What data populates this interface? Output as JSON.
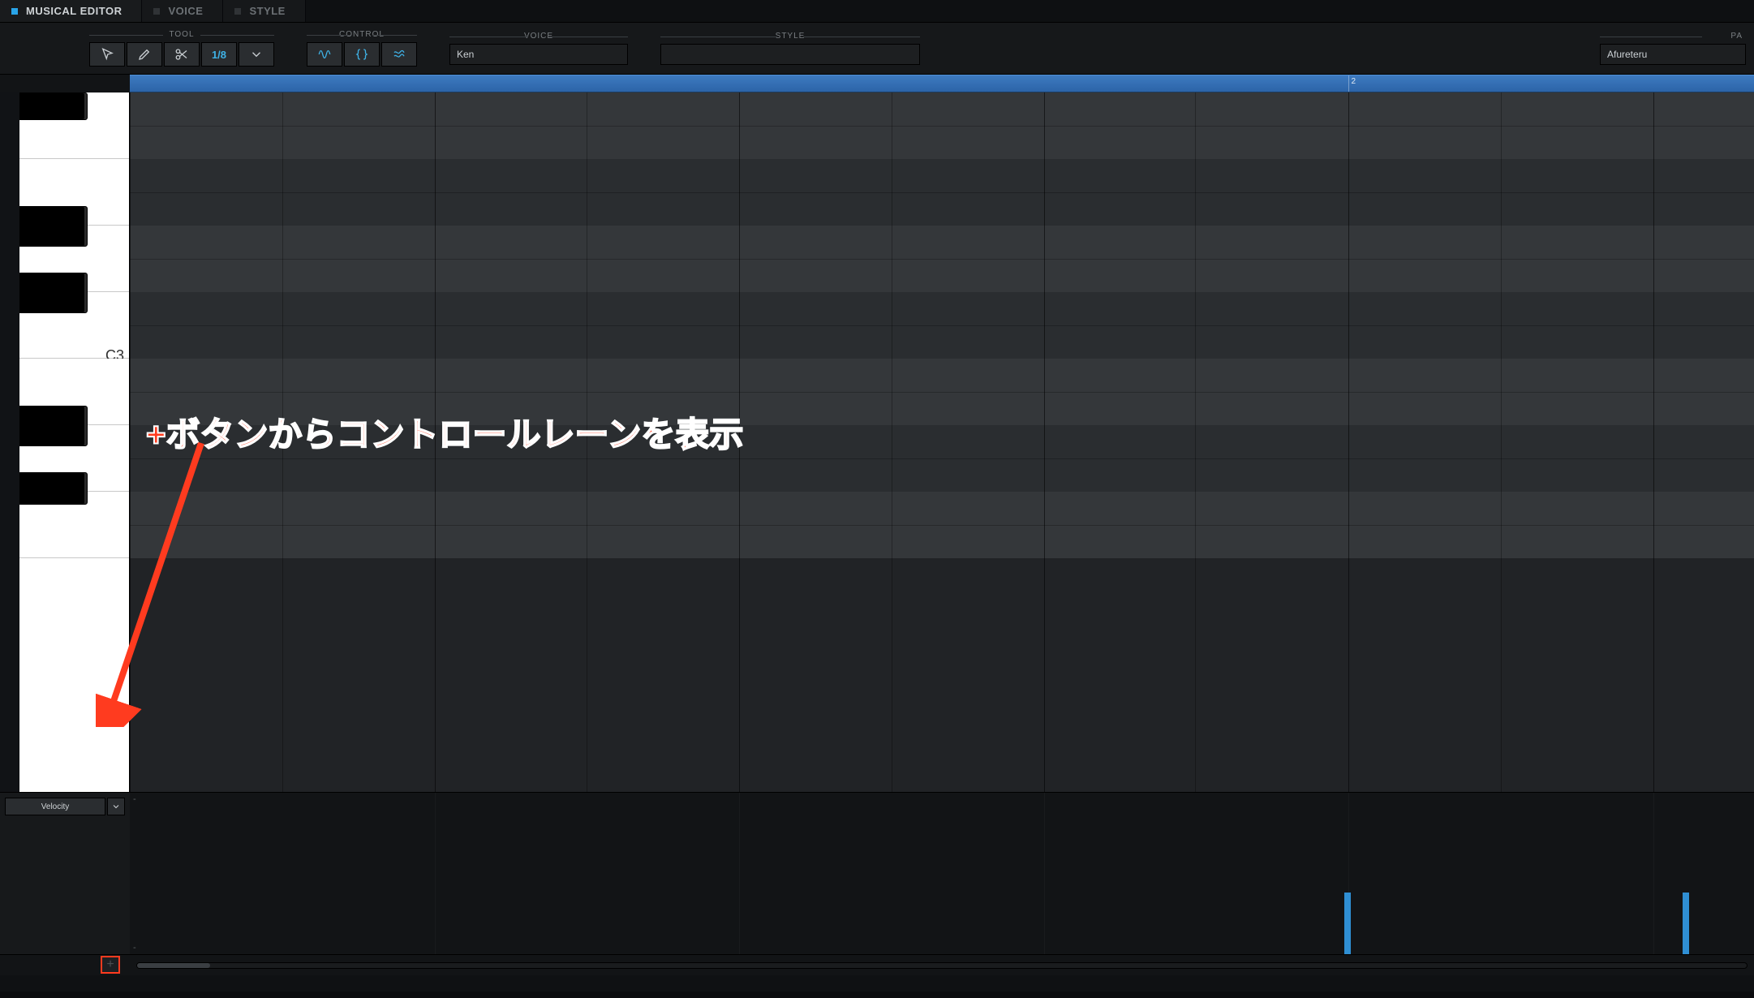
{
  "tabs": [
    {
      "label": "MUSICAL EDITOR",
      "active": true
    },
    {
      "label": "VOICE",
      "active": false
    },
    {
      "label": "STYLE",
      "active": false
    }
  ],
  "toolbar": {
    "tool_label": "TOOL",
    "control_label": "CONTROL",
    "voice_label": "VOICE",
    "style_label": "STYLE",
    "param_label": "PA",
    "quantize": "1/8",
    "voice_value": "Ken",
    "style_value": "",
    "param_value": "Afureteru"
  },
  "ruler": {
    "marks": [
      {
        "pos": 75,
        "label": "2"
      }
    ]
  },
  "piano": {
    "center_label": "C3"
  },
  "lane": {
    "selector": "Velocity",
    "tick_top": "-",
    "tick_bottom": "-",
    "bars": [
      {
        "pos": 74.8,
        "h": 38
      },
      {
        "pos": 95.6,
        "h": 38
      }
    ]
  },
  "annotation": {
    "text": "+ボタンからコントロールレーンを表示"
  },
  "icons": {
    "arrow": "arrow-tool",
    "pencil": "draw-tool",
    "scissors": "cut-tool",
    "chevron": "chevron-down",
    "wave": "wave",
    "braces": "braces",
    "approx": "approx"
  }
}
